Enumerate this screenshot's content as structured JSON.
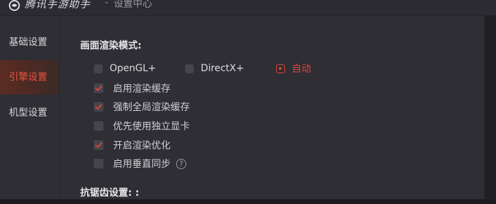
{
  "titlebar": {
    "app_name": "腾讯手游助手",
    "separator": "-",
    "section": "设置中心"
  },
  "sidebar": {
    "items": [
      {
        "label": "基础设置",
        "active": false
      },
      {
        "label": "引擎设置",
        "active": true
      },
      {
        "label": "机型设置",
        "active": false
      }
    ]
  },
  "render_mode": {
    "title": "画面渲染模式:",
    "options": [
      {
        "label": "OpenGL+",
        "selected": false
      },
      {
        "label": "DirectX+",
        "selected": false
      },
      {
        "label": "自动",
        "selected": true
      }
    ]
  },
  "checkboxes": [
    {
      "label": "启用渲染缓存",
      "checked": true
    },
    {
      "label": "强制全局渲染缓存",
      "checked": true
    },
    {
      "label": "优先使用独立显卡",
      "checked": false
    },
    {
      "label": "开启渲染优化",
      "checked": true
    },
    {
      "label": "启用垂直同步",
      "checked": false,
      "help": "?"
    }
  ],
  "antialias": {
    "title": "抗锯齿设置: :"
  },
  "colors": {
    "accent": "#e0473a",
    "background": "#2e2e34",
    "text": "#d6d6da"
  }
}
